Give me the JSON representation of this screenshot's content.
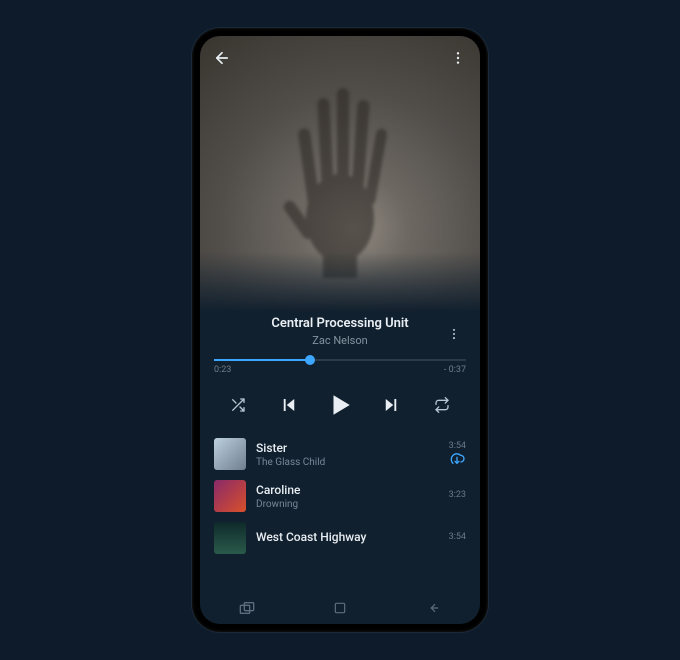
{
  "player": {
    "track_title": "Central Processing Unit",
    "artist": "Zac Nelson",
    "elapsed": "0:23",
    "remaining": "- 0:37",
    "progress_pct": 38,
    "icons": {
      "back": "arrow-left",
      "more": "more-vertical",
      "shuffle": "shuffle",
      "prev": "skip-back",
      "play": "play",
      "next": "skip-forward",
      "repeat": "repeat"
    }
  },
  "queue": [
    {
      "title": "Sister",
      "artist": "The Glass Child",
      "duration": "3:54",
      "cloud": true
    },
    {
      "title": "Caroline",
      "artist": "Drowning",
      "duration": "3:23",
      "cloud": false
    },
    {
      "title": "West Coast Highway",
      "artist": "",
      "duration": "3:54",
      "cloud": false
    }
  ],
  "nav_icons": {
    "recents": "recents",
    "home": "square",
    "back": "back"
  },
  "colors": {
    "accent": "#3da6ff",
    "bg": "#11202e",
    "page_bg": "#0d1b2a"
  }
}
